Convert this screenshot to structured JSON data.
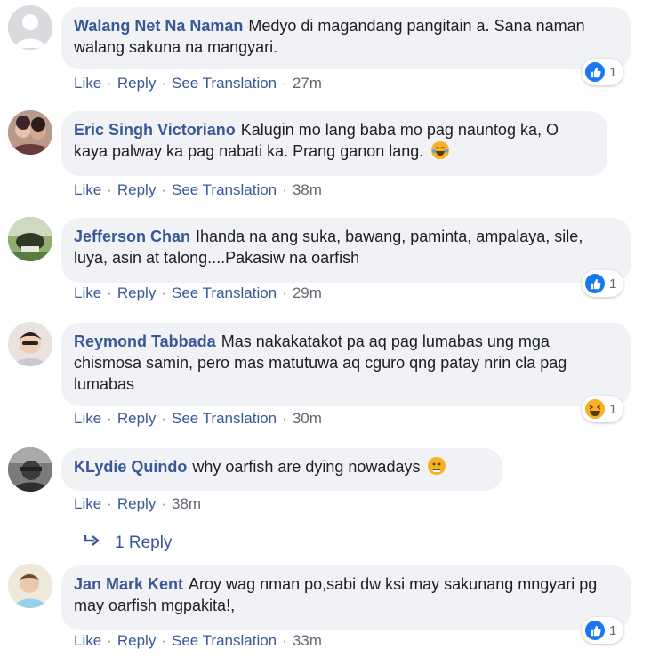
{
  "actions": {
    "like": "Like",
    "reply": "Reply",
    "see_translation": "See Translation"
  },
  "comments": [
    {
      "author": "Walang Net Na Naman",
      "text": "Medyo di magandang pangitain a. Sana naman walang sakuna na mangyari.",
      "time": "27m",
      "reaction": {
        "icon": "like-icon",
        "count": "1"
      },
      "avatar": "default-avatar"
    },
    {
      "author": "Eric Singh Victoriano",
      "text": "Kalugin mo lang baba mo pag nauntog ka, O kaya palway ka pag nabati ka. Prang ganon lang.",
      "time": "38m",
      "emoji": "laughing-tears-emoji",
      "avatar": "user-photo-avatar"
    },
    {
      "author": "Jefferson Chan",
      "text": "Ihanda na ang suka, bawang, paminta, ampalaya, sile, luya, asin at talong....Pakasiw na oarfish",
      "time": "29m",
      "reaction": {
        "icon": "like-icon",
        "count": "1"
      },
      "avatar": "user-photo-avatar"
    },
    {
      "author": "Reymond Tabbada",
      "text": "Mas nakakatakot pa aq pag lumabas ung mga chismosa samin, pero mas matutuwa aq cguro qng patay nrin cla pag lumabas",
      "time": "30m",
      "reaction": {
        "icon": "haha-icon",
        "count": "1"
      },
      "avatar": "user-photo-avatar"
    },
    {
      "author": "KLydie Quindo",
      "text": "why oarfish are dying nowadays",
      "time": "38m",
      "emoji": "sad-face-emoji",
      "avatar": "user-photo-avatar"
    },
    {
      "author": "Jan Mark Kent",
      "text": "Aroy wag nman po,sabi dw ksi may sakunang mngyari pg may oarfish mgpakita!,",
      "time": "33m",
      "reaction": {
        "icon": "like-icon",
        "count": "1"
      },
      "avatar": "user-photo-avatar"
    }
  ],
  "replies_link": {
    "label": "1 Reply",
    "icon": "reply-arrow-icon"
  },
  "colors": {
    "author": "#385898",
    "bubble": "#f0f2f5",
    "like_blue": "#1877f2",
    "emoji_yellow": "#f7b125"
  }
}
